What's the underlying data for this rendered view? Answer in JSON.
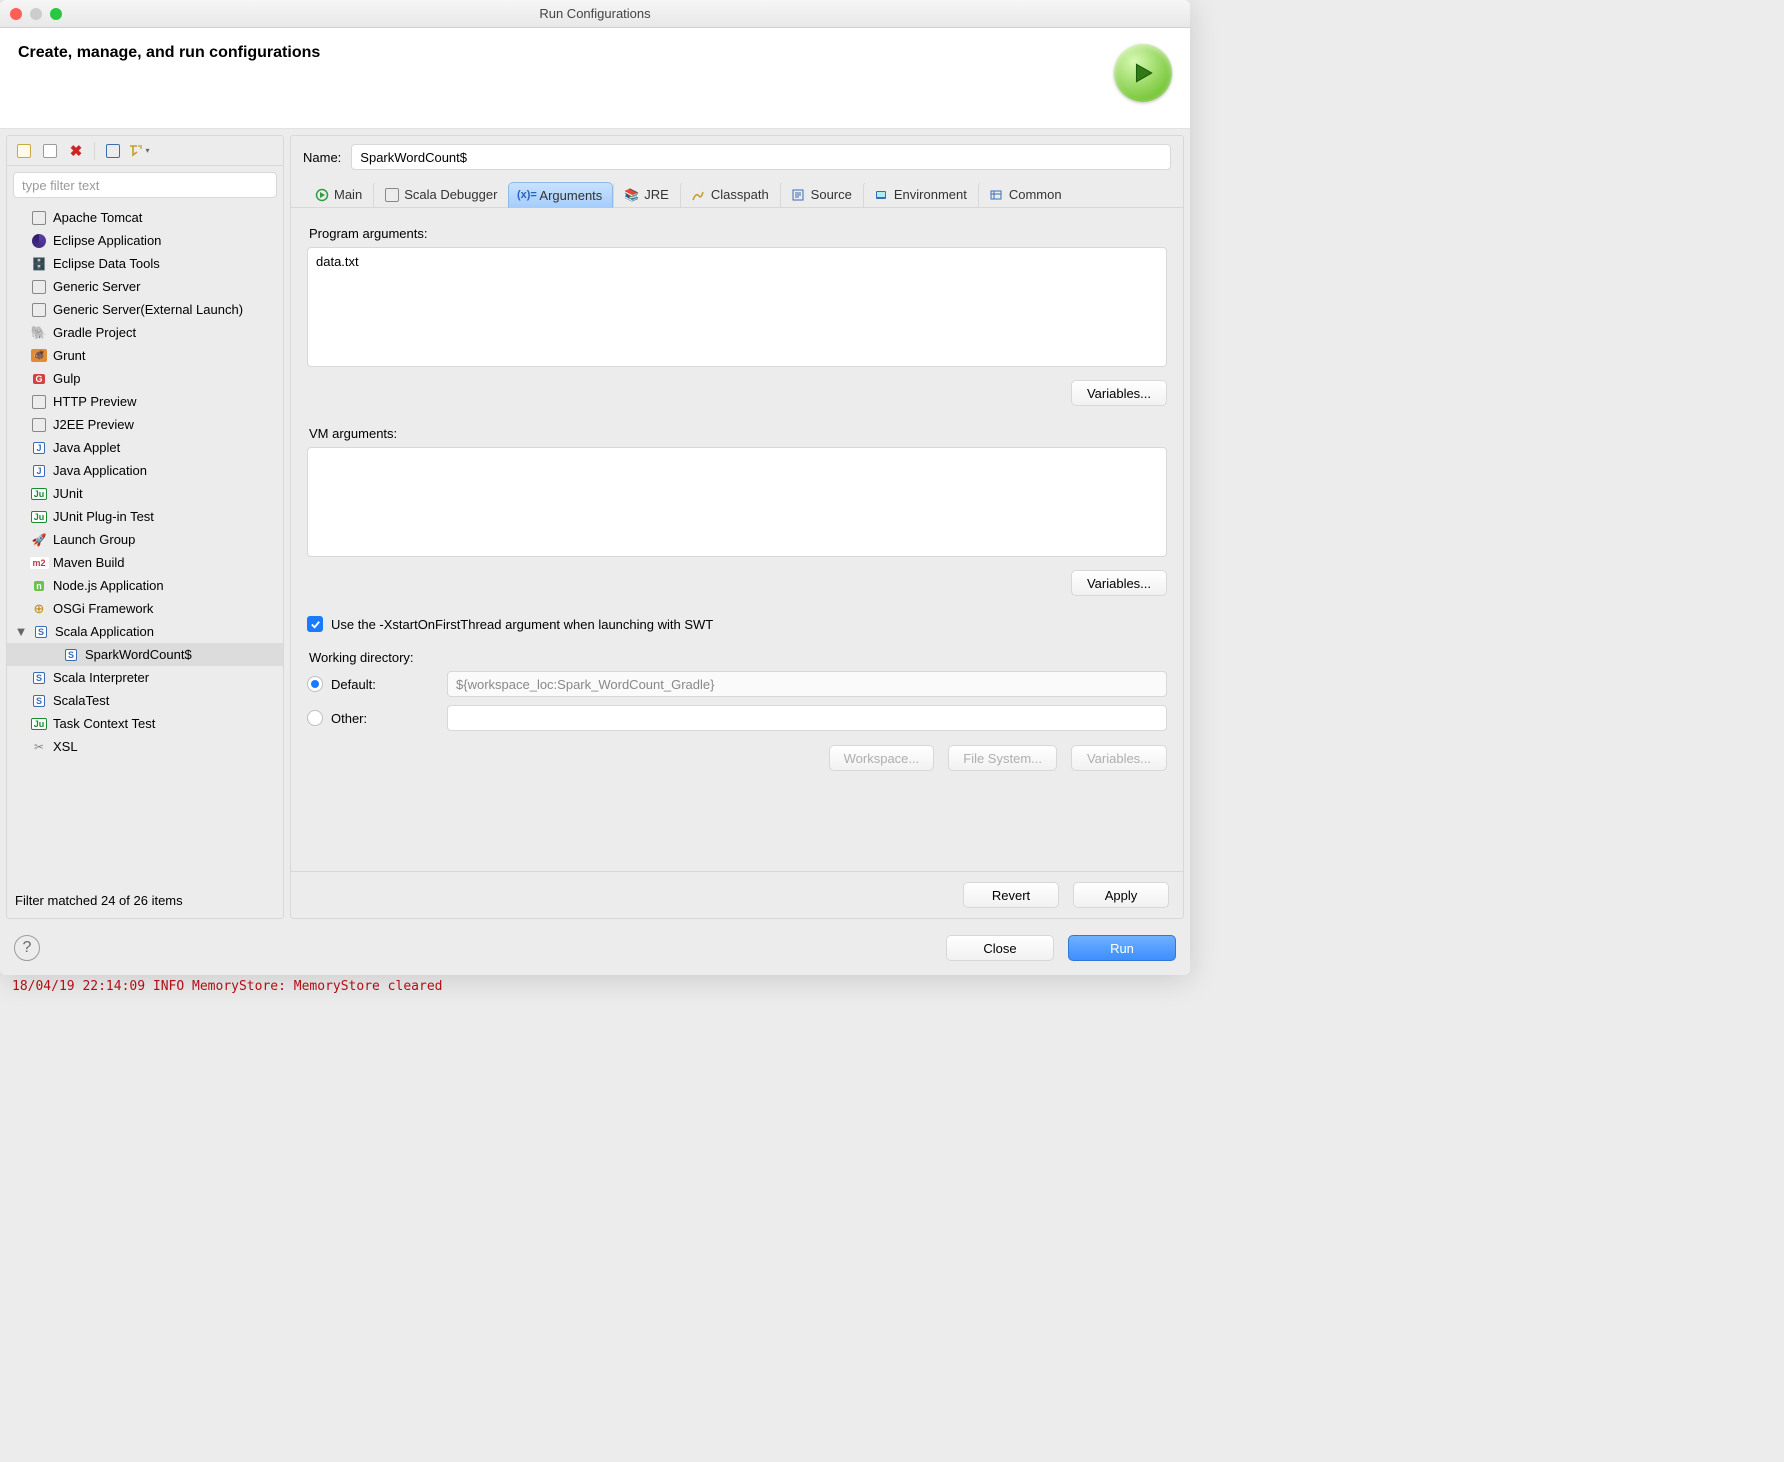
{
  "titlebar": {
    "title": "Run Configurations"
  },
  "header": {
    "title": "Create, manage, and run configurations"
  },
  "sidebar": {
    "filter_placeholder": "type filter text",
    "status": "Filter matched 24 of 26 items",
    "items": [
      {
        "label": "Apache Tomcat"
      },
      {
        "label": "Eclipse Application"
      },
      {
        "label": "Eclipse Data Tools"
      },
      {
        "label": "Generic Server"
      },
      {
        "label": "Generic Server(External Launch)"
      },
      {
        "label": "Gradle Project"
      },
      {
        "label": "Grunt"
      },
      {
        "label": "Gulp"
      },
      {
        "label": "HTTP Preview"
      },
      {
        "label": "J2EE Preview"
      },
      {
        "label": "Java Applet"
      },
      {
        "label": "Java Application"
      },
      {
        "label": "JUnit"
      },
      {
        "label": "JUnit Plug-in Test"
      },
      {
        "label": "Launch Group"
      },
      {
        "label": "Maven Build"
      },
      {
        "label": "Node.js Application"
      },
      {
        "label": "OSGi Framework"
      },
      {
        "label": "Scala Application",
        "expanded": true,
        "children": [
          {
            "label": "SparkWordCount$",
            "selected": true
          }
        ]
      },
      {
        "label": "Scala Interpreter"
      },
      {
        "label": "ScalaTest"
      },
      {
        "label": "Task Context Test"
      },
      {
        "label": "XSL"
      }
    ]
  },
  "form": {
    "name_label": "Name:",
    "name_value": "SparkWordCount$",
    "tabs": [
      {
        "label": "Main"
      },
      {
        "label": "Scala Debugger"
      },
      {
        "label": "Arguments",
        "active": true
      },
      {
        "label": "JRE"
      },
      {
        "label": "Classpath"
      },
      {
        "label": "Source"
      },
      {
        "label": "Environment"
      },
      {
        "label": "Common"
      }
    ],
    "arguments": {
      "program_label": "Program arguments:",
      "program_value": "data.txt",
      "vm_label": "VM arguments:",
      "vm_value": "",
      "variables_label": "Variables...",
      "swt_checkbox_label": "Use the -XstartOnFirstThread argument when launching with SWT",
      "swt_checked": true,
      "wd_label": "Working directory:",
      "wd_default_label": "Default:",
      "wd_default_value": "${workspace_loc:Spark_WordCount_Gradle}",
      "wd_other_label": "Other:",
      "wd_other_value": "",
      "wd_workspace": "Workspace...",
      "wd_filesystem": "File System...",
      "wd_variables": "Variables..."
    },
    "revert": "Revert",
    "apply": "Apply"
  },
  "footer": {
    "close": "Close",
    "run": "Run"
  },
  "console": {
    "line": "18/04/19 22:14:09 INFO MemoryStore: MemoryStore cleared"
  }
}
